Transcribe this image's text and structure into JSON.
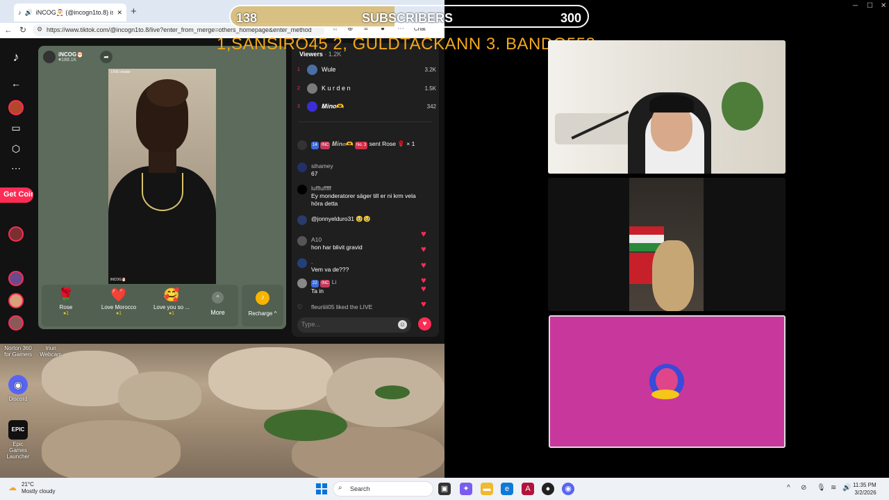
{
  "browser": {
    "tab_title": "iNCOG🎅 (@incogn1to.8) is L",
    "tab_close": "✕",
    "new_tab": "+",
    "url": "https://www.tiktok.com/@incogn1to.8/live?enter_from_merge=others_homepage&enter_method",
    "chat_label": "Chat"
  },
  "tiktok": {
    "get_coins": "Get Coins",
    "host": {
      "name": "iNCOG🎅",
      "likes": "♥188.1K"
    },
    "live_badge": "LIVE creator",
    "video_tag": "iNCOG🎅",
    "gifts": [
      {
        "name": "Rose",
        "price": "●1",
        "icon": "🌹"
      },
      {
        "name": "Love Morocco",
        "price": "●1",
        "icon": "❤️"
      },
      {
        "name": "Love you so ...",
        "price": "●1",
        "icon": "🥰"
      }
    ],
    "more_label": "More",
    "recharge_label": "Recharge ^",
    "viewers_label": "Viewers",
    "viewers_count": "· 1.2K",
    "top_viewers": [
      {
        "rank": "1",
        "name": "Wule",
        "value": "3.2K",
        "color": "#4a6fa5"
      },
      {
        "rank": "2",
        "name": "K u r d e n",
        "value": "1.5K",
        "color": "#7a7a7a"
      },
      {
        "rank": "3",
        "name": "𝑴𝒊𝒏𝒐🫶",
        "value": "342",
        "color": "#3a2ed6"
      }
    ],
    "messages": [
      {
        "user": "𝑴𝒊𝒏𝒐🫶",
        "badges": [
          "14",
          "INC",
          "No. 3"
        ],
        "text": "sent Rose 🌹 × 1",
        "color": "#1f1f1f"
      },
      {
        "user": "sihamey",
        "badges": [],
        "text": "67",
        "color": "#22306a"
      },
      {
        "user": "lufflufffff",
        "badges": [],
        "text": "Ey monderatorer säger till er ni krm vela höra detta",
        "color": "#111"
      },
      {
        "user": "",
        "badges": [],
        "text": "@jonnyelduro31 🥹🥹",
        "color": "#2a3a6a"
      },
      {
        "user": "A10",
        "badges": [],
        "text": "hon har blivit gravid",
        "color": "#555"
      },
      {
        "user": ".",
        "badges": [],
        "text": "Vem va de???",
        "color": "#24407a"
      },
      {
        "user": "Li",
        "badges": [
          "22",
          "INC"
        ],
        "text": "Ta in",
        "color": "#888"
      },
      {
        "user": "",
        "badges": [],
        "text": "fleuriiii05 liked the LIVE",
        "color": "#1f1f1f"
      }
    ],
    "type_placeholder": "Type..."
  },
  "overlay": {
    "current": "138",
    "label": "SUBSCRIBERS",
    "goal": "300",
    "progress": 0.46,
    "ranking": "1,SANSIRO45  2, GULDTACKANN 3. BANDO558"
  },
  "desktop_icons": [
    {
      "label": "Norton 360 for Gamers",
      "color": "#e8c21a"
    },
    {
      "label": "Iriun Webcam",
      "color": "#444"
    },
    {
      "label": "Discord",
      "color": "#5865f2"
    },
    {
      "label": "Epic Games Launcher",
      "color": "#111"
    }
  ],
  "taskbar": {
    "temp": "21°C",
    "weather": "Mostly cloudy",
    "search": "Search",
    "time": "11:35 PM",
    "date": "3/2/2026"
  }
}
